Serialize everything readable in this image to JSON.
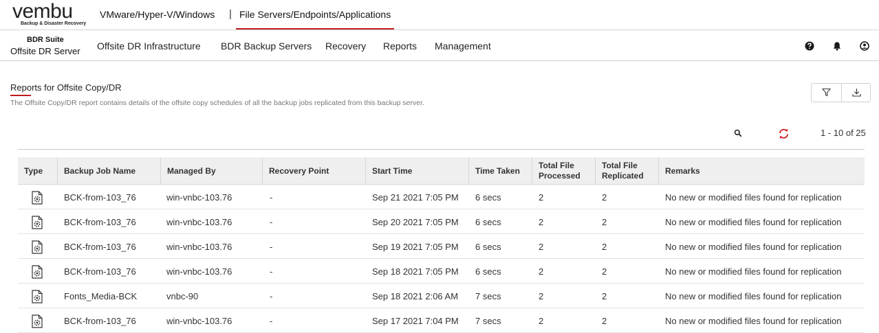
{
  "top_nav": {
    "logo_word": "vembu",
    "logo_tagline": "Backup & Disaster Recovery",
    "tabs": [
      {
        "label": "VMware/Hyper-V/Windows"
      },
      {
        "label": "File Servers/Endpoints/Applications",
        "active": true
      }
    ],
    "separator": "|",
    "accent_color": "#c0181d"
  },
  "main_nav": {
    "brand_line1": "BDR Suite",
    "brand_line2": "Offsite DR Server",
    "items": [
      {
        "label": "Offsite DR Infrastructure"
      },
      {
        "label": "BDR Backup Servers"
      },
      {
        "label": "Recovery"
      },
      {
        "label": "Reports"
      },
      {
        "label": "Management"
      }
    ],
    "icons": [
      "help-icon",
      "bell-icon",
      "user-icon"
    ]
  },
  "page": {
    "title": "Reports for Offsite Copy/DR",
    "description": "The Offsite Copy/DR report contains details of the offsite copy schedules of all the backup jobs replicated from this backup server.",
    "toolbar_icons": [
      "filter-icon",
      "download-icon"
    ],
    "pagination": "1 - 10 of 25"
  },
  "table": {
    "columns": [
      {
        "key": "type",
        "label": "Type"
      },
      {
        "key": "job",
        "label": "Backup Job Name"
      },
      {
        "key": "managed",
        "label": "Managed By"
      },
      {
        "key": "recovery",
        "label": "Recovery Point"
      },
      {
        "key": "start",
        "label": "Start Time"
      },
      {
        "key": "taken",
        "label": "Time Taken"
      },
      {
        "key": "processed",
        "label": "Total File Processed"
      },
      {
        "key": "replicated",
        "label": "Total File Replicated"
      },
      {
        "key": "remarks",
        "label": "Remarks"
      }
    ],
    "rows": [
      {
        "type": "file-settings-icon",
        "job": "BCK-from-103_76",
        "managed": "win-vnbc-103.76",
        "recovery": "-",
        "start": "Sep 21 2021 7:05 PM",
        "taken": "6 secs",
        "processed": "2",
        "replicated": "2",
        "remarks": "No new or modified files found for replication"
      },
      {
        "type": "file-settings-icon",
        "job": "BCK-from-103_76",
        "managed": "win-vnbc-103.76",
        "recovery": "-",
        "start": "Sep 20 2021 7:05 PM",
        "taken": "6 secs",
        "processed": "2",
        "replicated": "2",
        "remarks": "No new or modified files found for replication"
      },
      {
        "type": "file-settings-icon",
        "job": "BCK-from-103_76",
        "managed": "win-vnbc-103.76",
        "recovery": "-",
        "start": "Sep 19 2021 7:05 PM",
        "taken": "6 secs",
        "processed": "2",
        "replicated": "2",
        "remarks": "No new or modified files found for replication"
      },
      {
        "type": "file-settings-icon",
        "job": "BCK-from-103_76",
        "managed": "win-vnbc-103.76",
        "recovery": "-",
        "start": "Sep 18 2021 7:05 PM",
        "taken": "6 secs",
        "processed": "2",
        "replicated": "2",
        "remarks": "No new or modified files found for replication"
      },
      {
        "type": "file-settings-icon",
        "job": "Fonts_Media-BCK",
        "managed": "vnbc-90",
        "recovery": "-",
        "start": "Sep 18 2021 2:06 AM",
        "taken": "7 secs",
        "processed": "2",
        "replicated": "2",
        "remarks": "No new or modified files found for replication"
      },
      {
        "type": "file-settings-icon",
        "job": "BCK-from-103_76",
        "managed": "win-vnbc-103.76",
        "recovery": "-",
        "start": "Sep 17 2021 7:04 PM",
        "taken": "7 secs",
        "processed": "2",
        "replicated": "2",
        "remarks": "No new or modified files found for replication"
      }
    ]
  }
}
